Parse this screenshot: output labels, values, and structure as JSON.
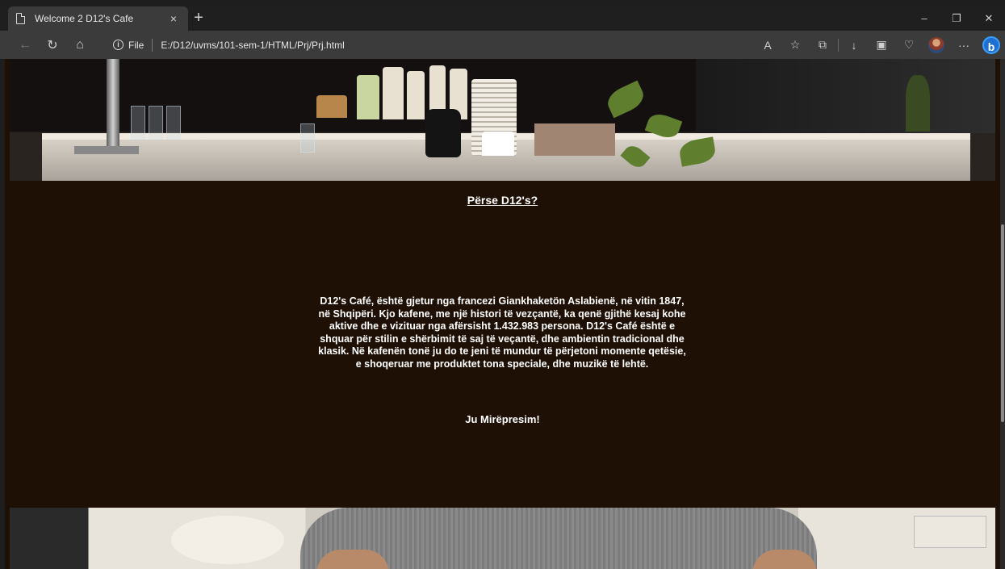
{
  "browser": {
    "tab_title": "Welcome 2 D12's Cafe",
    "tab_close": "×",
    "new_tab": "+",
    "window_controls": {
      "minimize": "–",
      "restore": "❐",
      "close": "✕"
    },
    "address": {
      "scheme_label": "File",
      "url": "E:/D12/uvms/101-sem-1/HTML/Prj/Prj.html",
      "info_glyph": "i"
    },
    "nav": {
      "back": "←",
      "reload": "↻",
      "home": "⌂"
    },
    "tools": {
      "read_aloud": "A",
      "favorite": "☆",
      "extensions": "⧉",
      "downloads": "↓",
      "collections": "▣",
      "browser_essentials": "♡",
      "more": "···",
      "bing": "b"
    }
  },
  "icons": [
    "page-icon",
    "back-icon",
    "reload-icon",
    "home-icon",
    "info-icon",
    "read-aloud-icon",
    "favorite-icon",
    "extensions-icon",
    "downloads-icon",
    "collections-icon",
    "essentials-icon",
    "profile-avatar",
    "more-icon",
    "bing-icon"
  ],
  "page": {
    "about": {
      "heading": "Përse D12's?",
      "paragraph": "D12's Café, është gjetur nga francezi Giankhaketön Aslabienë, në vitin 1847, në Shqipëri. Kjo kafene, me një histori të vezçantë, ka qenë gjithë kesaj kohe aktive dhe e vizituar nga afërsisht 1.432.983 persona. D12's Café është e shquar për stilin e shërbimit të saj të veçantë, dhe ambientin tradicional dhe klasik. Në kafenën tonë ju do te jeni të mundur të përjetoni momente qetësie, e shoqeruar me produktet tona speciale, dhe muzikë të lehtë.",
      "welcome": "Ju Mirëpresim!"
    }
  },
  "colors": {
    "page_bg": "#1e1005",
    "text": "#ffffff",
    "chrome_dark": "#1f1f1f",
    "chrome_mid": "#3b3b3b"
  }
}
